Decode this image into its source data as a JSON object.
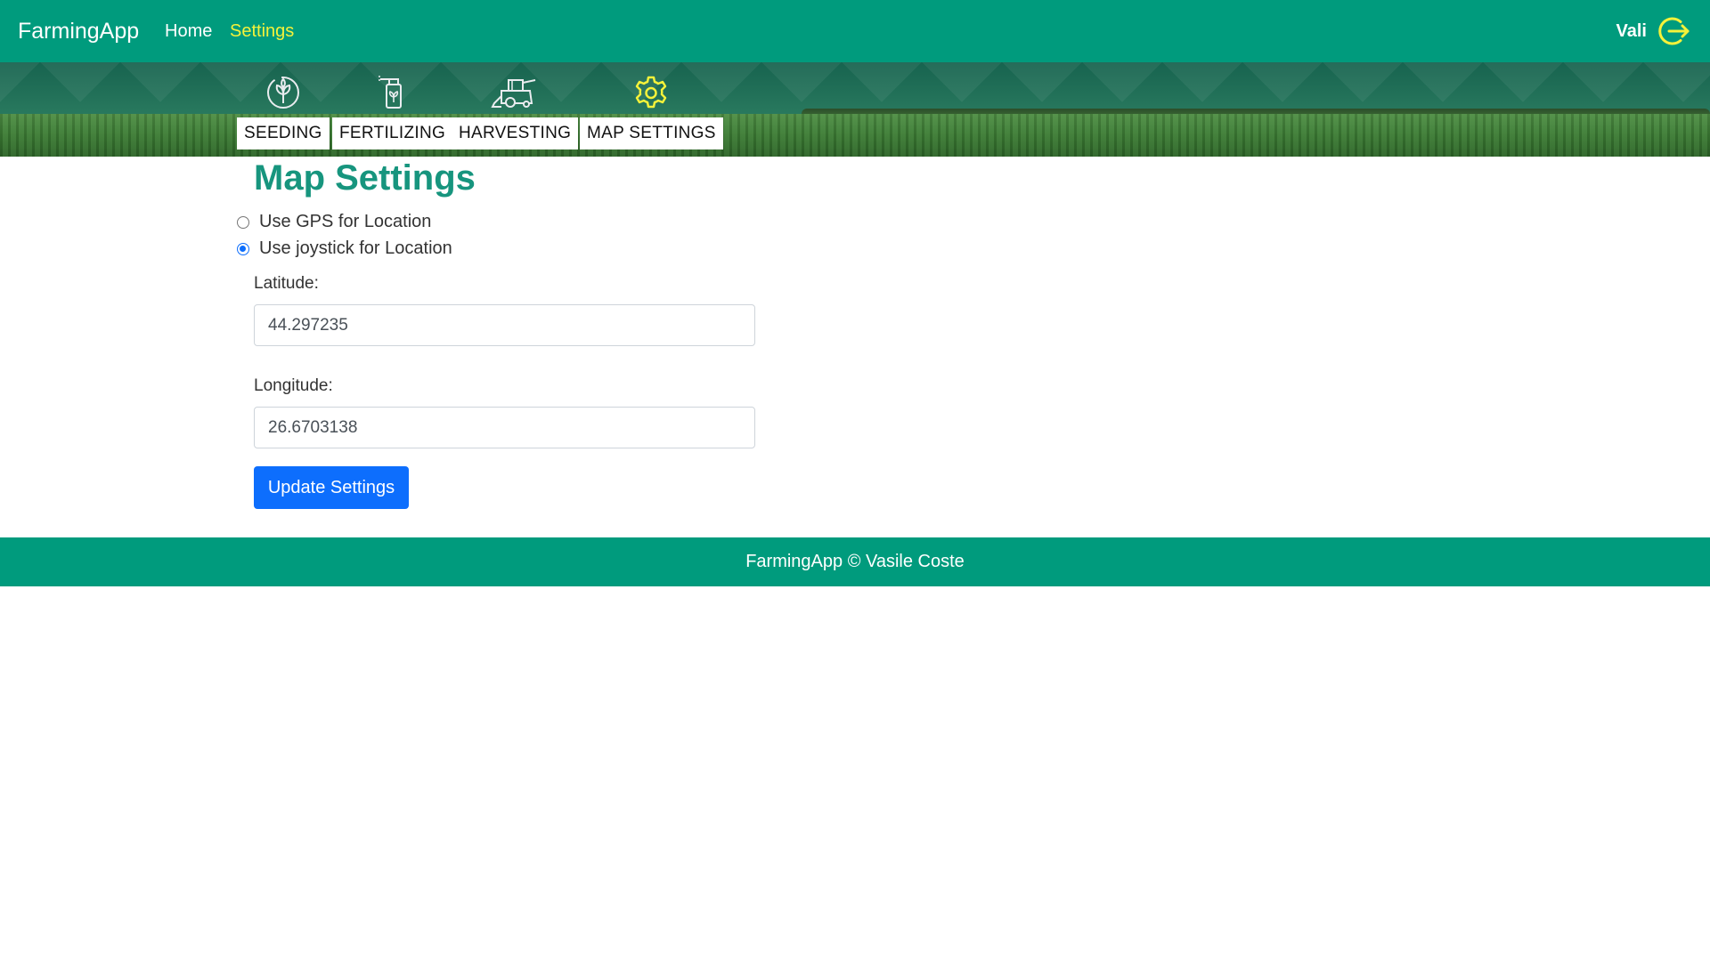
{
  "nav": {
    "brand": "FarmingApp",
    "links": [
      {
        "label": "Home",
        "active": false
      },
      {
        "label": "Settings",
        "active": true
      }
    ],
    "user": "Vali",
    "logout_icon": "logout-icon",
    "colors": {
      "bar": "#009b7d",
      "active_link": "#f5f23a"
    }
  },
  "tabs": [
    {
      "label": "SEEDING",
      "icon": "seedling-icon"
    },
    {
      "label": "FERTILIZING",
      "icon": "fertilizer-sprayer-icon"
    },
    {
      "label": "HARVESTING",
      "icon": "combine-harvester-icon"
    },
    {
      "label": "MAP SETTINGS",
      "icon": "gear-icon",
      "active": true
    }
  ],
  "main": {
    "title": "Map Settings",
    "location_options": [
      {
        "label": "Use GPS for Location",
        "checked": false
      },
      {
        "label": "Use joystick for Location",
        "checked": true
      }
    ],
    "latitude": {
      "label": "Latitude:",
      "value": "44.297235"
    },
    "longitude": {
      "label": "Longitude:",
      "value": "26.6703138"
    },
    "submit_label": "Update Settings"
  },
  "footer": {
    "text": "FarmingApp © Vasile Coste"
  }
}
